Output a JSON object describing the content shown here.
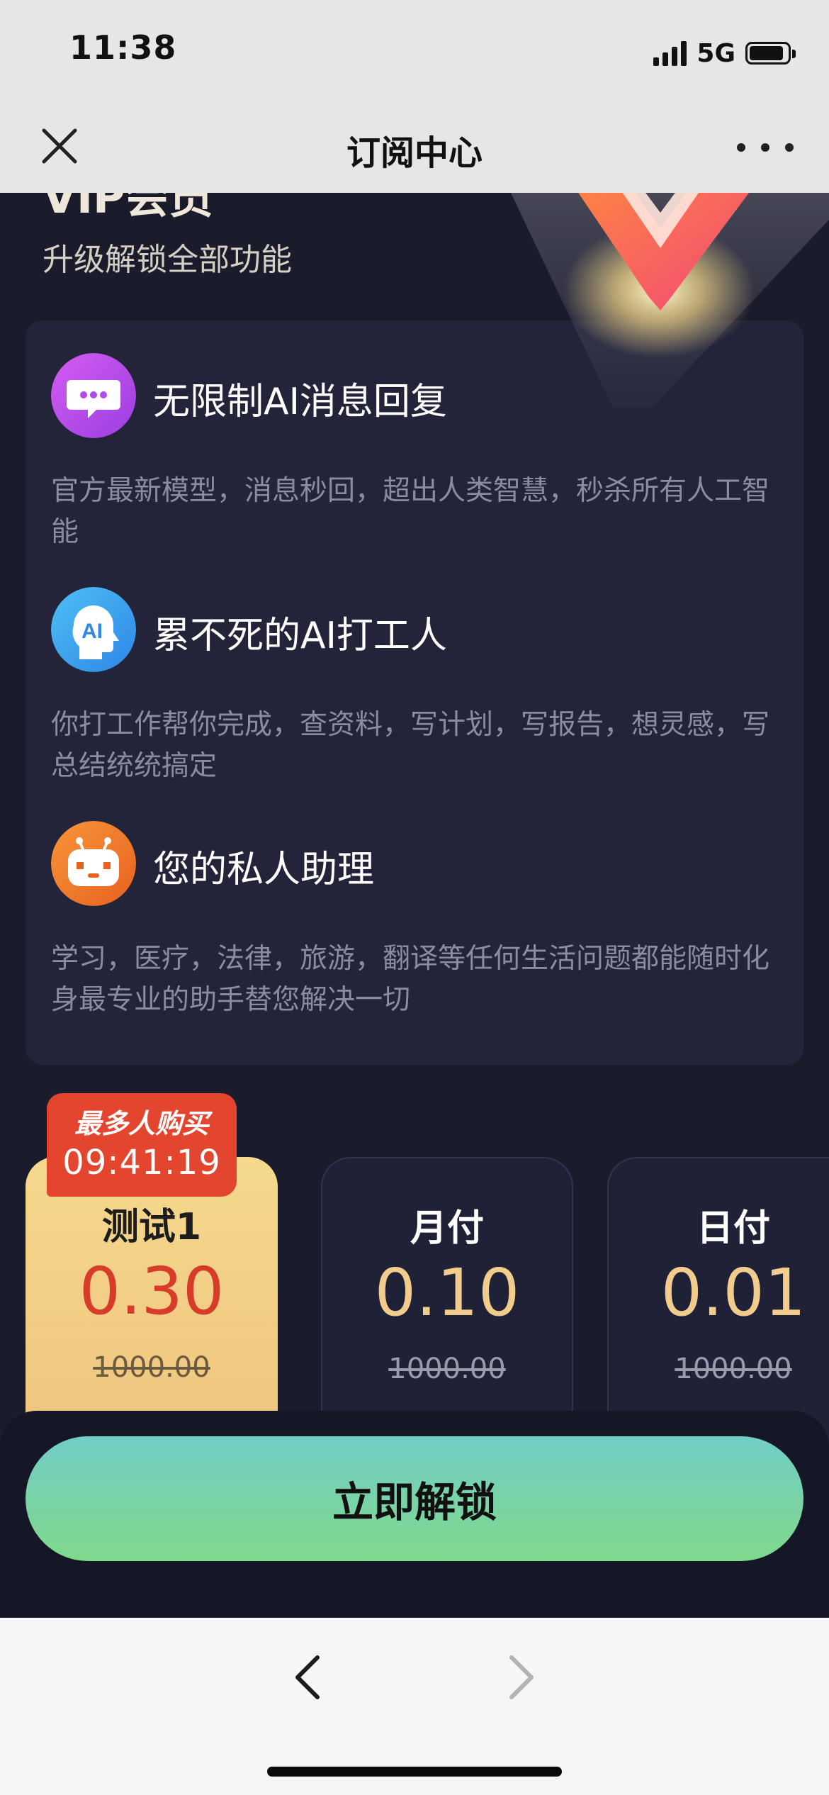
{
  "status_bar": {
    "time": "11:38",
    "network": "5G",
    "battery_level": 0.9
  },
  "nav": {
    "title": "订阅中心",
    "close_icon": "close-icon",
    "more_icon": "more-dots-icon"
  },
  "hero": {
    "title": "VIP会员",
    "subtitle": "升级解锁全部功能",
    "graphic_icon": "vip-v-badge-icon"
  },
  "features": [
    {
      "icon": "chat-bubble-icon",
      "title": "无限制AI消息回复",
      "description": "官方最新模型，消息秒回，超出人类智慧，秒杀所有人工智能",
      "icon_color": "#c552e6"
    },
    {
      "icon": "ai-head-icon",
      "title": "累不死的AI打工人",
      "description": "你打工作帮你完成，查资料，写计划，写报告，想灵感，写总结统统搞定",
      "icon_color": "#3fa2f0"
    },
    {
      "icon": "robot-icon",
      "title": "您的私人助理",
      "description": "学习，医疗，法律，旅游，翻译等任何生活问题都能随时化身最专业的助手替您解决一切",
      "icon_color": "#f07a2c"
    }
  ],
  "promo": {
    "label": "最多人购买",
    "timer": "09:41:19"
  },
  "plans": [
    {
      "name": "测试1",
      "price": "0.30",
      "original_price": "1000.00",
      "selected": true
    },
    {
      "name": "月付",
      "price": "0.10",
      "original_price": "1000.00",
      "selected": false
    },
    {
      "name": "日付",
      "price": "0.01",
      "original_price": "1000.00",
      "selected": false
    }
  ],
  "cta": {
    "label": "立即解锁"
  },
  "browser_nav": {
    "back_icon": "chevron-left-icon",
    "forward_icon": "chevron-right-icon"
  },
  "colors": {
    "background": "#1a1b2b",
    "card": "#23243a",
    "price_selected": "#d73c2b",
    "price_gold": "#f2cc8c",
    "promo_red": "#e4452f",
    "cta_gradient_start": "#72cdc6",
    "cta_gradient_end": "#7fd98b"
  }
}
